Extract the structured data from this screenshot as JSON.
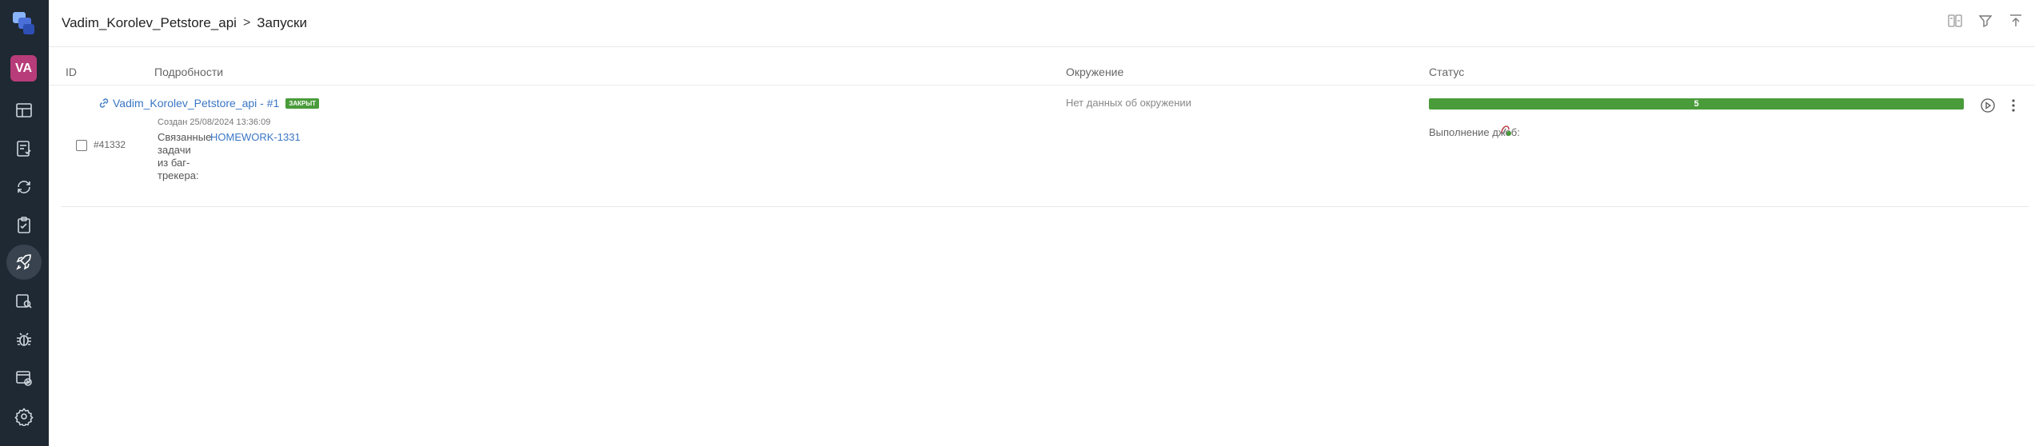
{
  "header": {
    "project": "Vadim_Korolev_Petstore_api",
    "separator": ">",
    "page": "Запуски"
  },
  "sidebar": {
    "avatar_initials": "VA",
    "items": [
      {
        "icon": "dashboard-icon"
      },
      {
        "icon": "test-cases-icon"
      },
      {
        "icon": "sync-icon"
      },
      {
        "icon": "checklist-icon"
      },
      {
        "icon": "launches-rocket-icon",
        "active": true
      },
      {
        "icon": "analytics-icon"
      },
      {
        "icon": "defects-bug-icon"
      },
      {
        "icon": "jobs-icon"
      },
      {
        "icon": "settings-gear-icon"
      }
    ]
  },
  "table": {
    "columns": {
      "id": "ID",
      "details": "Подробности",
      "env": "Окружение",
      "status": "Статус"
    },
    "rows": [
      {
        "id": "#41332",
        "name": "Vadim_Korolev_Petstore_api - #1",
        "badge": "ЗАКРЫТ",
        "created": "Создан 25/08/2024 13:36:09",
        "related_label_lines": [
          "Связанные",
          "задачи",
          "из баг-",
          "трекера:"
        ],
        "related_link": "HOMEWORK-1331",
        "env": "Нет данных об окружении",
        "passed_count": "5",
        "jobs_label": "Выполнение джоб:"
      }
    ]
  },
  "colors": {
    "sidebar": "#1f2933",
    "avatar": "#b83c79",
    "passed": "#4a9b3a",
    "link": "#3a76c4"
  }
}
